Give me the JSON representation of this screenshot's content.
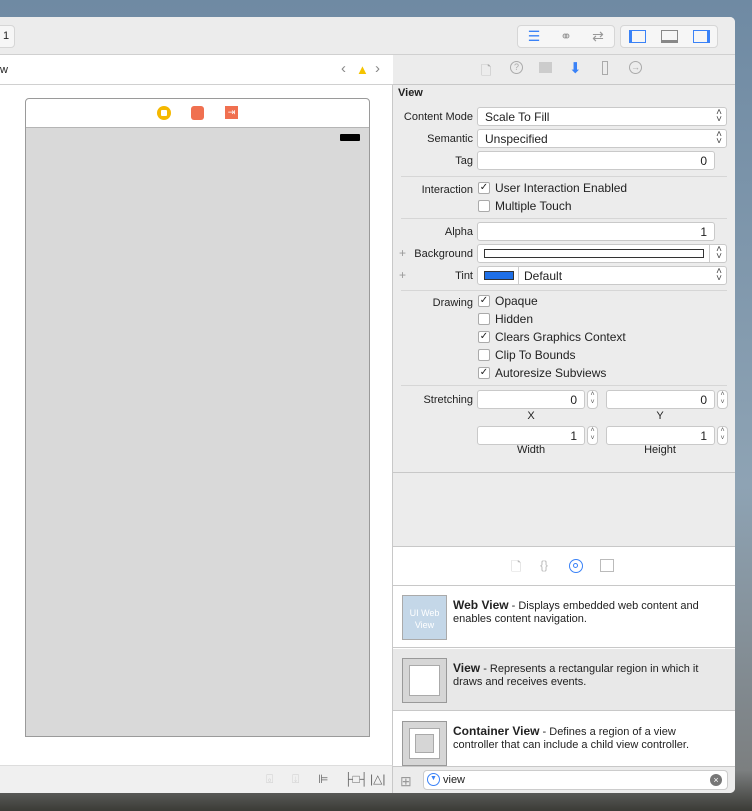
{
  "toolbar": {
    "left_label": "1"
  },
  "jumpbar": {
    "crumb": "w"
  },
  "inspector": {
    "section_title": "View",
    "content_mode": {
      "label": "Content Mode",
      "value": "Scale To Fill"
    },
    "semantic": {
      "label": "Semantic",
      "value": "Unspecified"
    },
    "tag": {
      "label": "Tag",
      "value": "0"
    },
    "interaction": {
      "label": "Interaction",
      "options": [
        {
          "label": "User Interaction Enabled",
          "checked": true
        },
        {
          "label": "Multiple Touch",
          "checked": false
        }
      ]
    },
    "alpha": {
      "label": "Alpha",
      "value": "1"
    },
    "background": {
      "label": "Background"
    },
    "tint": {
      "label": "Tint",
      "value": "Default",
      "color": "#1f6fe6"
    },
    "drawing": {
      "label": "Drawing",
      "options": [
        {
          "label": "Opaque",
          "checked": true
        },
        {
          "label": "Hidden",
          "checked": false
        },
        {
          "label": "Clears Graphics Context",
          "checked": true
        },
        {
          "label": "Clip To Bounds",
          "checked": false
        },
        {
          "label": "Autoresize Subviews",
          "checked": true
        }
      ]
    },
    "stretching": {
      "label": "Stretching",
      "x": "0",
      "y": "0",
      "width": "1",
      "height": "1",
      "x_label": "X",
      "y_label": "Y",
      "width_label": "Width",
      "height_label": "Height"
    }
  },
  "library": {
    "items": [
      {
        "title": "Web View",
        "desc": " - Displays embedded web content and enables content navigation.",
        "thumb_text": "UI Web View"
      },
      {
        "title": "View",
        "desc": " - Represents a rectangular region in which it draws and receives events."
      },
      {
        "title": "Container View",
        "desc": " - Defines a region of a view controller that can include a child view controller."
      }
    ],
    "filter_value": "view"
  },
  "colors": {
    "accent": "#3a82f7",
    "warning": "#f5c400"
  }
}
